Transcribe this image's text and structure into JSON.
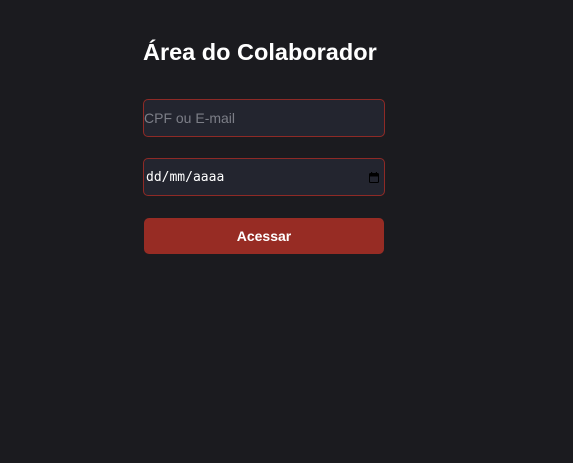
{
  "form": {
    "title": "Área do Colaborador",
    "login": {
      "placeholder": "CPF ou E-mail",
      "value": ""
    },
    "birthdate": {
      "placeholder": "dd/mm/aaaa",
      "icon": "calendar-icon"
    },
    "submit_label": "Acessar"
  },
  "colors": {
    "background": "#1b1b1f",
    "field_background": "#23252f",
    "field_border": "#8e2a26",
    "button": "#972c24",
    "text": "#ffffff",
    "placeholder": "#7c7e87"
  }
}
